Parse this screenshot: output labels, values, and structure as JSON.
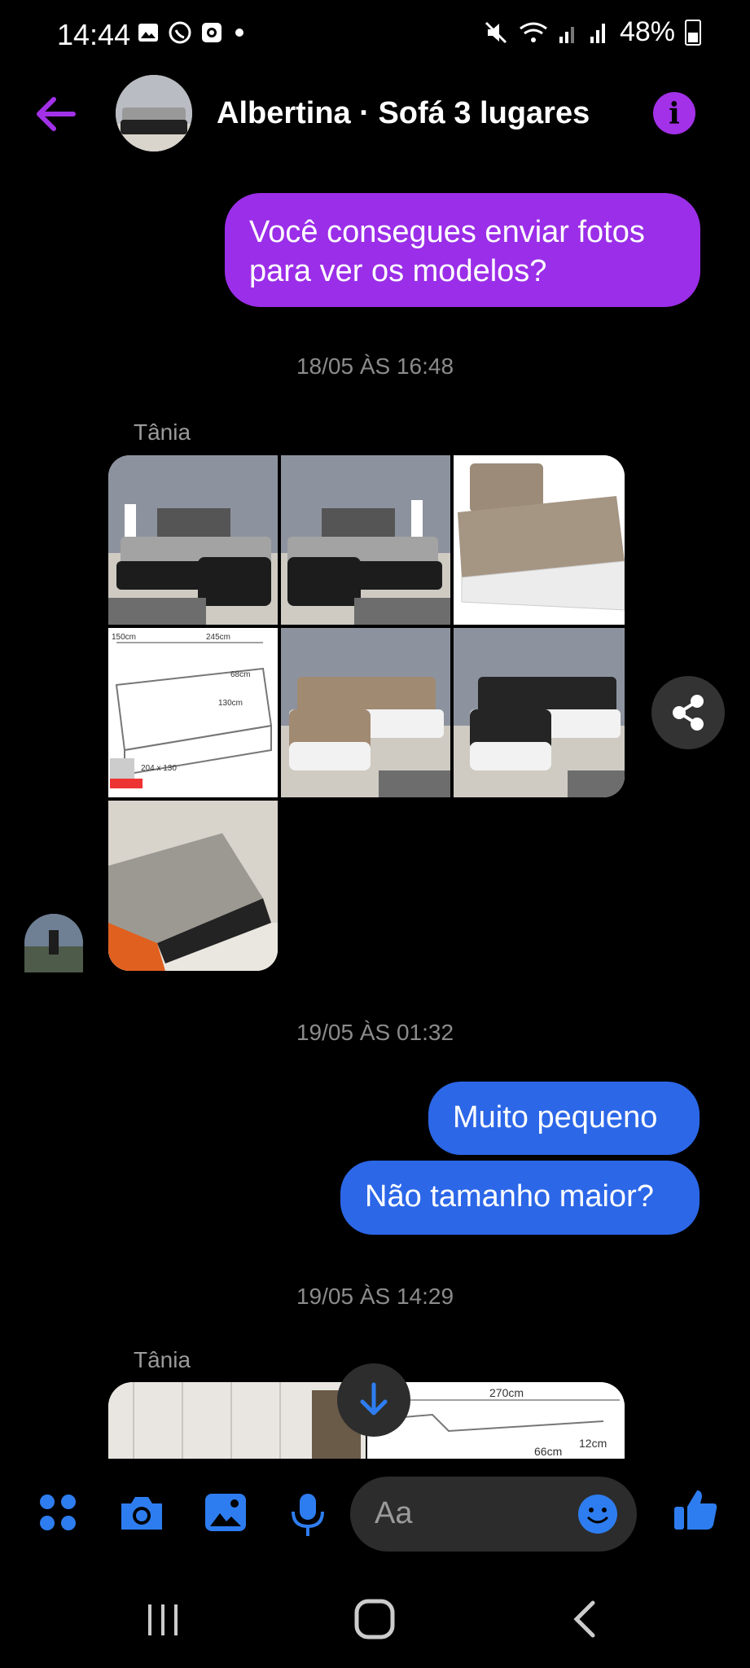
{
  "status_bar": {
    "time": "14:44",
    "battery": "48%"
  },
  "header": {
    "title": "Albertina · Sofá 3 lugares",
    "info_glyph": "i"
  },
  "messages": {
    "outgoing_1": "Você consegues enviar fotos para ver os modelos?",
    "timestamp_1": "18/05 ÀS 16:48",
    "sender_1": "Tânia",
    "timestamp_2": "19/05 ÀS 01:32",
    "outgoing_2": "Muito pequeno",
    "outgoing_3": "Não tamanho maior?",
    "timestamp_3": "19/05 ÀS 14:29",
    "sender_2": "Tânia"
  },
  "diagram_labels": {
    "w1": "150cm",
    "w2": "245cm",
    "d1": "68cm",
    "d2": "130cm",
    "bed": "204 x 130",
    "h1": "270cm",
    "h2": "66cm",
    "h3": "12cm"
  },
  "composer": {
    "placeholder": "Aa"
  },
  "icons": [
    "back-arrow-icon",
    "info-icon",
    "share-icon",
    "scroll-down-icon",
    "apps-icon",
    "camera-icon",
    "gallery-icon",
    "mic-icon",
    "emoji-icon",
    "thumbs-up-icon",
    "recents-icon",
    "home-icon",
    "back-nav-icon"
  ],
  "colors": {
    "accent_purple": "#9b2ee8",
    "accent_blue": "#2c67e8",
    "icon_blue": "#2e7df0"
  }
}
